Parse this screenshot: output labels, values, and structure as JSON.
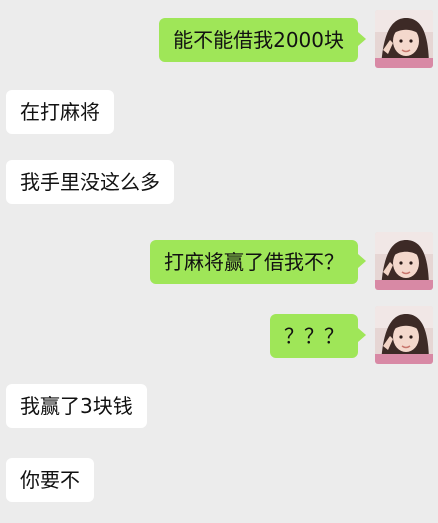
{
  "background": "#ececec",
  "colors": {
    "outgoing_bubble": "#9fe658",
    "incoming_bubble": "#ffffff",
    "text": "#111111"
  },
  "avatar": {
    "icon": "user-avatar-photo"
  },
  "messages": [
    {
      "side": "right",
      "text": "能不能借我2000块"
    },
    {
      "side": "left",
      "text": "在打麻将"
    },
    {
      "side": "left",
      "text": "我手里没这么多"
    },
    {
      "side": "right",
      "text": "打麻将赢了借我不？"
    },
    {
      "side": "right",
      "text": "？？？"
    },
    {
      "side": "left",
      "text": "我赢了3块钱"
    },
    {
      "side": "left",
      "text": "你要不"
    }
  ]
}
